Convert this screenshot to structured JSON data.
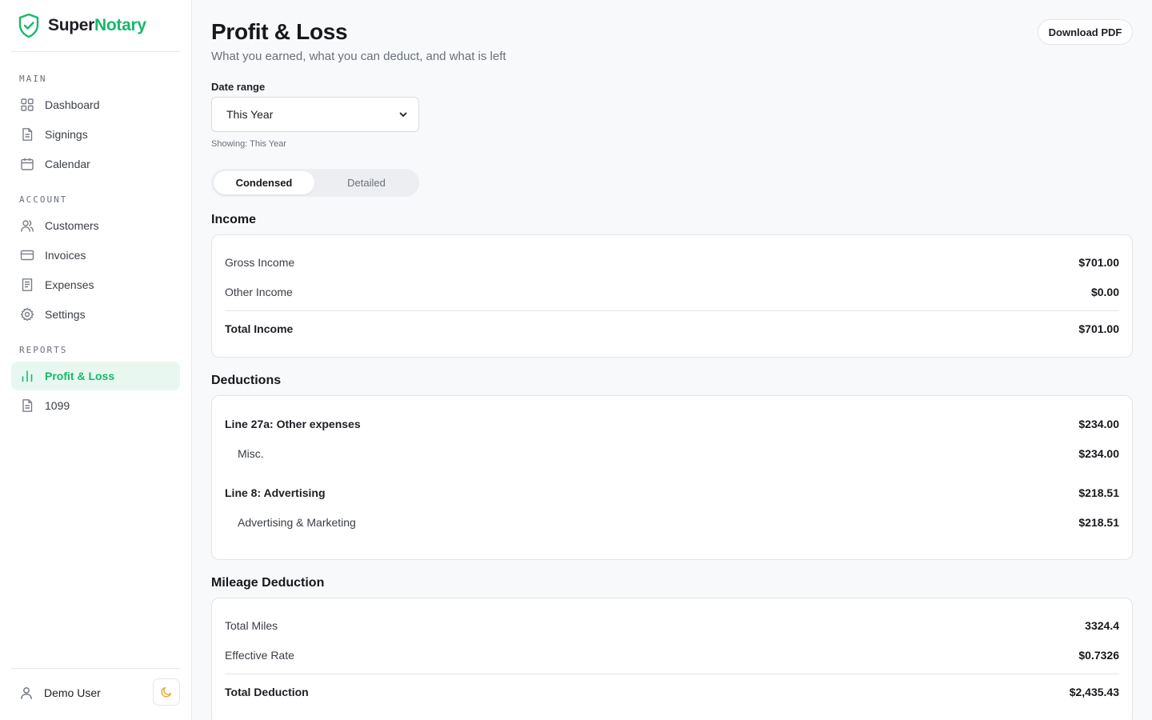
{
  "brand": {
    "name_part1": "Super",
    "name_part2": "Notary"
  },
  "sidebar": {
    "sections": [
      {
        "label": "MAIN",
        "items": [
          {
            "label": "Dashboard",
            "icon": "grid-icon"
          },
          {
            "label": "Signings",
            "icon": "document-icon"
          },
          {
            "label": "Calendar",
            "icon": "calendar-icon"
          }
        ]
      },
      {
        "label": "ACCOUNT",
        "items": [
          {
            "label": "Customers",
            "icon": "users-icon"
          },
          {
            "label": "Invoices",
            "icon": "credit-card-icon"
          },
          {
            "label": "Expenses",
            "icon": "receipt-icon"
          },
          {
            "label": "Settings",
            "icon": "gear-icon"
          }
        ]
      },
      {
        "label": "REPORTS",
        "items": [
          {
            "label": "Profit & Loss",
            "icon": "bar-chart-icon",
            "active": true
          },
          {
            "label": "1099",
            "icon": "document-icon"
          }
        ]
      }
    ],
    "user": {
      "name": "Demo User",
      "theme_icon": "moon-icon"
    }
  },
  "header": {
    "title": "Profit & Loss",
    "subtitle": "What you earned, what you can deduct, and what is left",
    "download_label": "Download PDF"
  },
  "filters": {
    "date_range_label": "Date range",
    "date_range_value": "This Year",
    "showing_text": "Showing: This Year",
    "view_options": [
      "Condensed",
      "Detailed"
    ],
    "view_selected": "Condensed"
  },
  "income": {
    "title": "Income",
    "rows": [
      {
        "label": "Gross Income",
        "value": "$701.00"
      },
      {
        "label": "Other Income",
        "value": "$0.00"
      }
    ],
    "total": {
      "label": "Total Income",
      "value": "$701.00"
    }
  },
  "deductions": {
    "title": "Deductions",
    "groups": [
      {
        "label": "Line 27a: Other expenses",
        "value": "$234.00",
        "items": [
          {
            "label": "Misc.",
            "value": "$234.00"
          }
        ]
      },
      {
        "label": "Line 8: Advertising",
        "value": "$218.51",
        "items": [
          {
            "label": "Advertising & Marketing",
            "value": "$218.51"
          }
        ]
      }
    ]
  },
  "mileage": {
    "title": "Mileage Deduction",
    "rows": [
      {
        "label": "Total Miles",
        "value": "3324.4"
      },
      {
        "label": "Effective Rate",
        "value": "$0.7326"
      }
    ],
    "total": {
      "label": "Total Deduction",
      "value": "$2,435.43"
    }
  },
  "colors": {
    "accent": "#16b96a",
    "accent_bg": "#e8f8f0",
    "moon": "#e3a82b"
  }
}
